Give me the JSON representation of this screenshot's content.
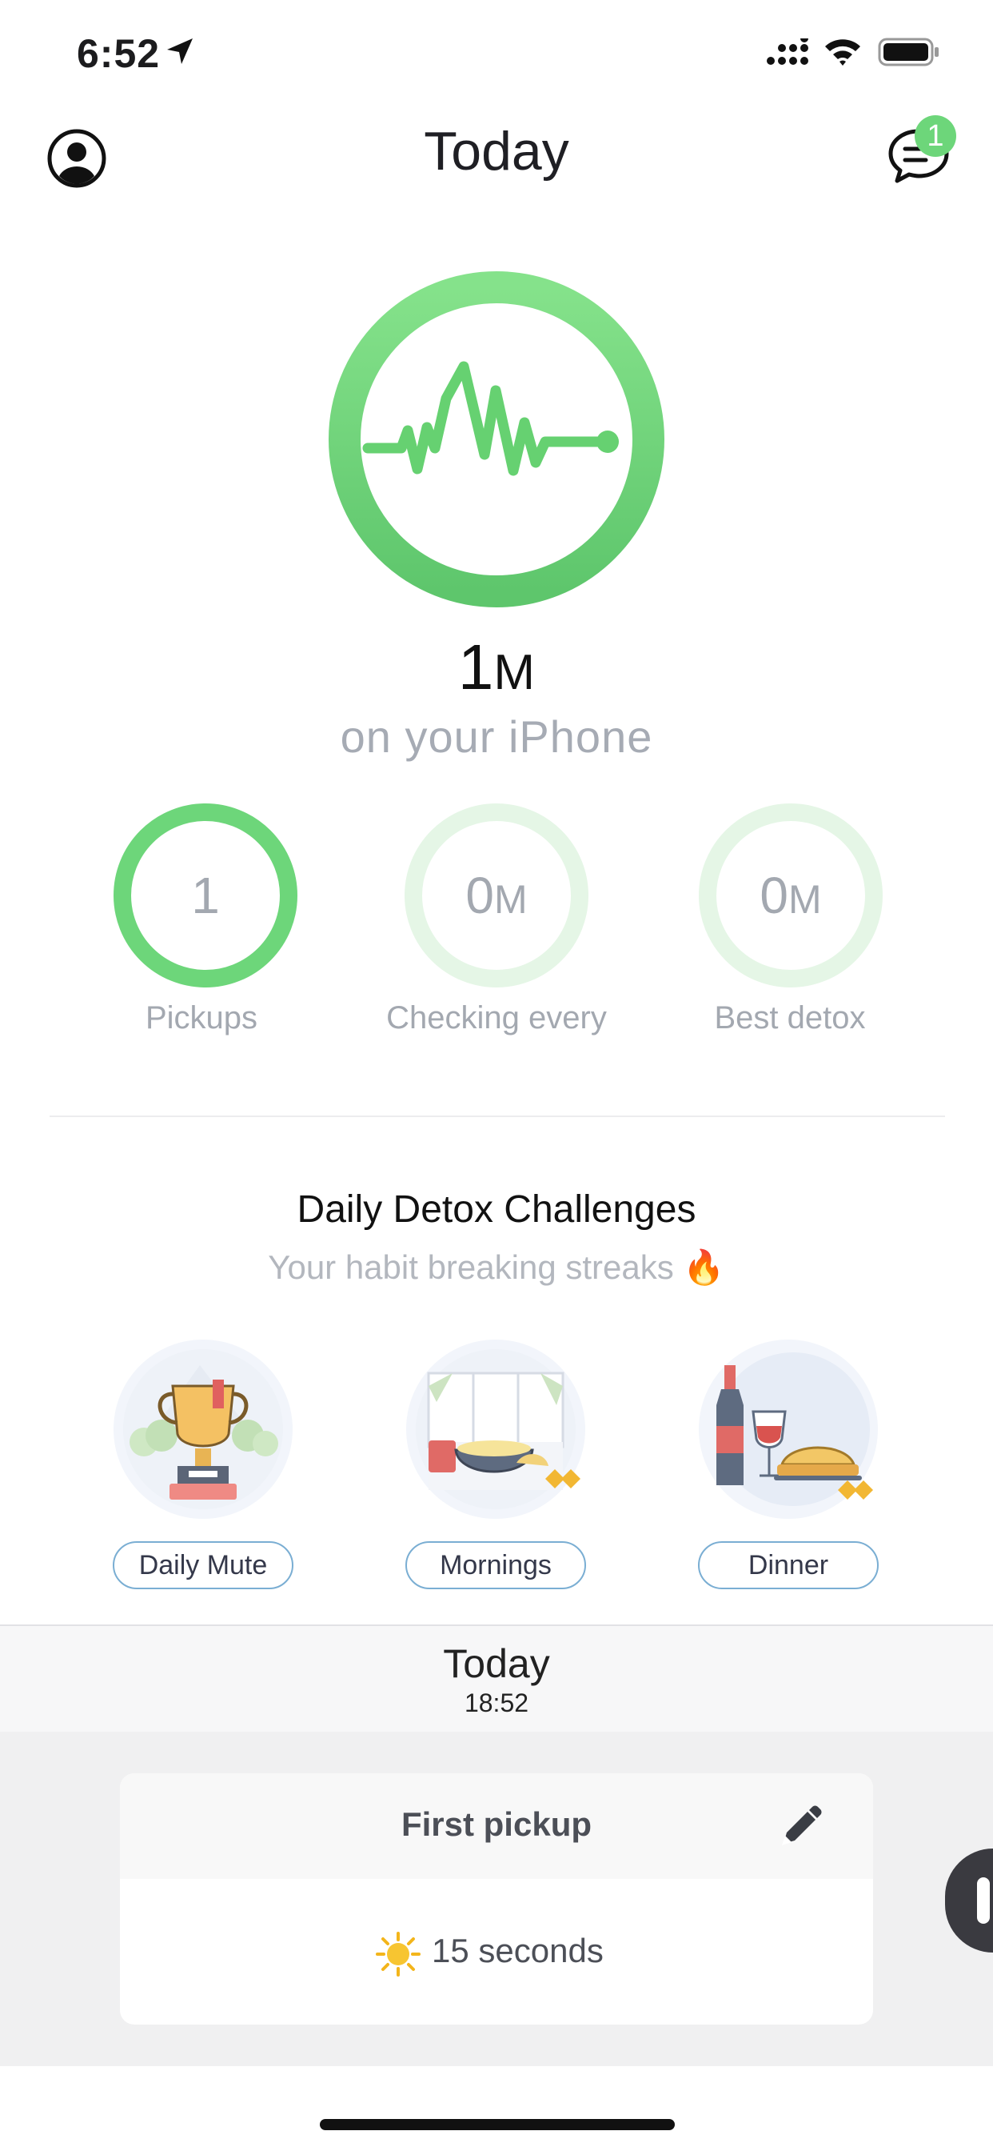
{
  "status_bar": {
    "time": "6:52"
  },
  "header": {
    "title": "Today",
    "chat_badge": "1"
  },
  "summary": {
    "value": "1",
    "unit": "M",
    "subtitle": "on your iPhone"
  },
  "stats": [
    {
      "value": "1",
      "unit": "",
      "label": "Pickups"
    },
    {
      "value": "0",
      "unit": "M",
      "label": "Checking every"
    },
    {
      "value": "0",
      "unit": "M",
      "label": "Best detox"
    }
  ],
  "challenges": {
    "title": "Daily Detox Challenges",
    "subtitle": "Your habit breaking streaks 🔥",
    "items": [
      {
        "label": "Daily Mute"
      },
      {
        "label": "Mornings"
      },
      {
        "label": "Dinner"
      }
    ]
  },
  "timeline": {
    "day": "Today",
    "time": "18:52",
    "card": {
      "title": "First pickup",
      "duration": "15 seconds"
    }
  },
  "colors": {
    "accent_green": "#6dd67a",
    "pill_border": "#7aaed3",
    "muted_text": "#a3a8b0"
  }
}
